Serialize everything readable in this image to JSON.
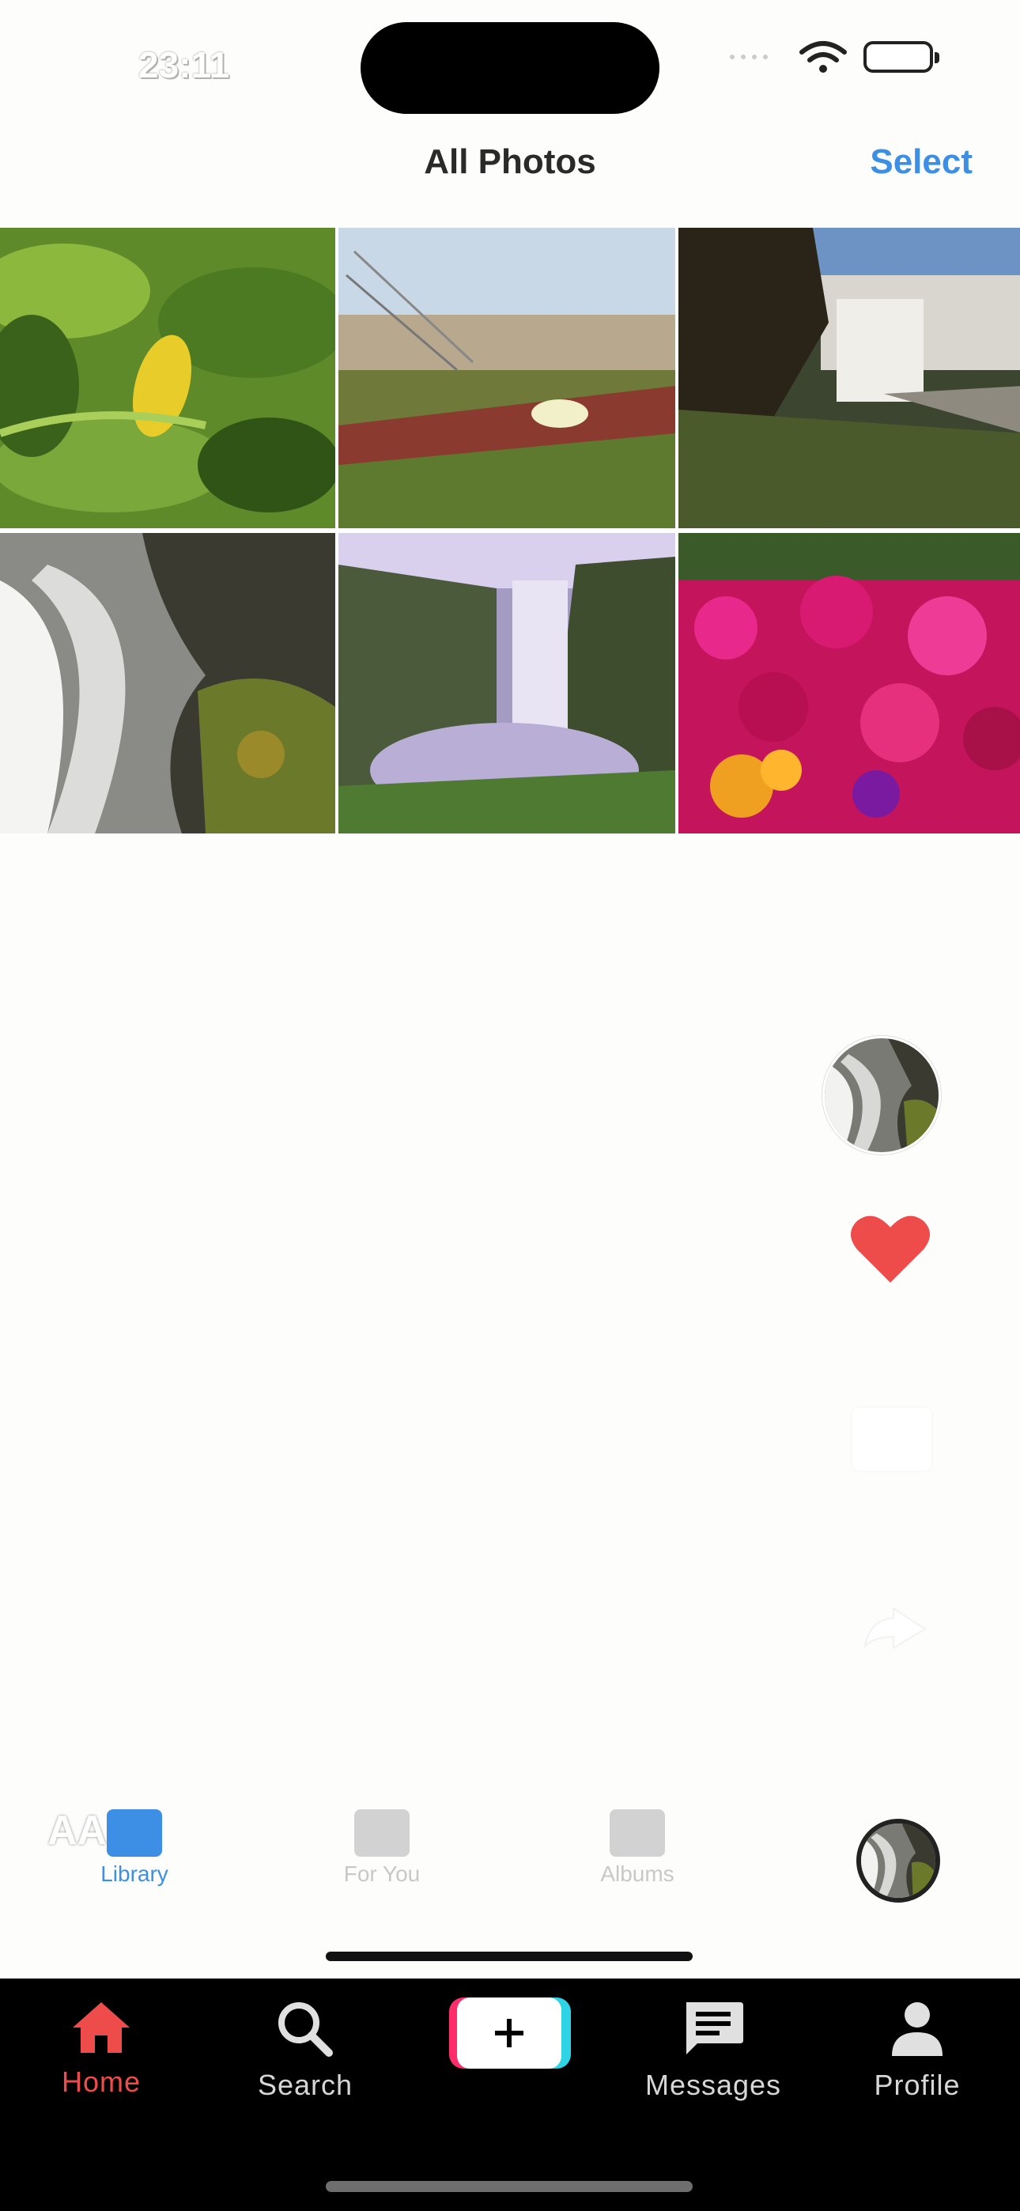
{
  "status_bar": {
    "time": "23:11"
  },
  "header": {
    "title": "All Photos",
    "select_label": "Select"
  },
  "photos": [
    {
      "name": "photo-lemon-leaves"
    },
    {
      "name": "photo-calla-lily-dunes"
    },
    {
      "name": "photo-waterfall-cliff"
    },
    {
      "name": "photo-waterfall-bw-moss"
    },
    {
      "name": "photo-purple-waterfall"
    },
    {
      "name": "photo-magenta-flowers"
    }
  ],
  "overlay": {
    "letters": "AA"
  },
  "photos_tabs": [
    {
      "label": "Library"
    },
    {
      "label": "For You"
    },
    {
      "label": "Albums"
    }
  ],
  "tabbar": {
    "home": "Home",
    "search": "Search",
    "create": "+",
    "messages": "Messages",
    "profile": "Profile"
  },
  "colors": {
    "accent": "#ee4b4b",
    "select_blue": "#3d8fe6",
    "tabbar_bg": "#000000"
  }
}
